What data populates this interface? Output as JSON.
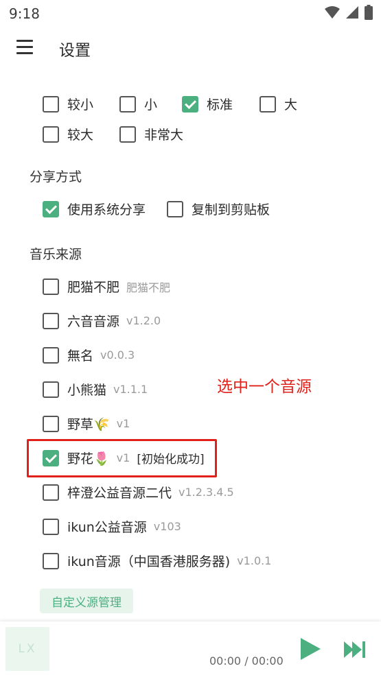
{
  "status_bar": {
    "time": "9:18"
  },
  "appbar": {
    "title": "设置"
  },
  "font_size": {
    "options": [
      {
        "label": "较小",
        "checked": false
      },
      {
        "label": "小",
        "checked": false
      },
      {
        "label": "标准",
        "checked": true
      },
      {
        "label": "大",
        "checked": false
      },
      {
        "label": "较大",
        "checked": false
      },
      {
        "label": "非常大",
        "checked": false
      }
    ]
  },
  "share": {
    "heading": "分享方式",
    "options": [
      {
        "label": "使用系统分享",
        "checked": true
      },
      {
        "label": "复制到剪贴板",
        "checked": false
      }
    ]
  },
  "music_source": {
    "heading": "音乐来源",
    "sources": [
      {
        "name": "肥猫不肥",
        "version": "肥猫不肥",
        "checked": false
      },
      {
        "name": "六音音源",
        "version": "v1.2.0",
        "checked": false
      },
      {
        "name": "無名",
        "version": "v0.0.3",
        "checked": false
      },
      {
        "name": "小熊猫",
        "version": "v1.1.1",
        "checked": false
      },
      {
        "name": "野草🌾",
        "version": "v1",
        "checked": false
      },
      {
        "name": "野花🌷",
        "version": "v1",
        "status": "[初始化成功]",
        "checked": true
      },
      {
        "name": "梓澄公益音源二代",
        "version": "v1.2.3.4.5",
        "checked": false
      },
      {
        "name": "ikun公益音源",
        "version": "v103",
        "checked": false
      },
      {
        "name": "ikun音源（中国香港服务器)",
        "version": "v1.0.1",
        "checked": false
      }
    ],
    "manage_label": "自定义源管理"
  },
  "annotation": "选中一个音源",
  "player": {
    "cover_text": "LX",
    "time": "00:00 / 00:00"
  },
  "colors": {
    "accent": "#4caf7f",
    "annotation": "#e0211a"
  }
}
